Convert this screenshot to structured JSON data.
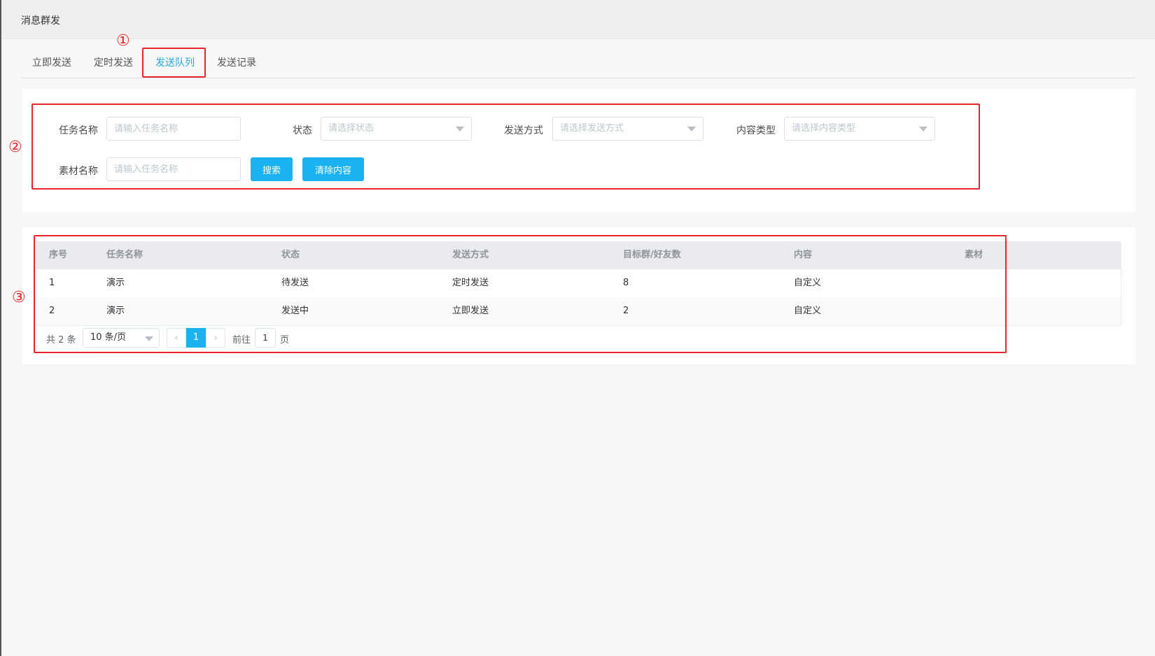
{
  "header": {
    "title": "消息群发"
  },
  "tabs": [
    {
      "label": "立即发送",
      "active": false
    },
    {
      "label": "定时发送",
      "active": false
    },
    {
      "label": "发送队列",
      "active": true
    },
    {
      "label": "发送记录",
      "active": false
    }
  ],
  "filters": {
    "task_name": {
      "label": "任务名称",
      "placeholder": "请输入任务名称"
    },
    "status": {
      "label": "状态",
      "placeholder": "请选择状态"
    },
    "send_method": {
      "label": "发送方式",
      "placeholder": "请选择发送方式"
    },
    "content_type": {
      "label": "内容类型",
      "placeholder": "请选择内容类型"
    },
    "material_name": {
      "label": "素材名称",
      "placeholder": "请输入任务名称"
    },
    "search_label": "搜索",
    "clear_label": "清除内容"
  },
  "table": {
    "columns": [
      "序号",
      "任务名称",
      "状态",
      "发送方式",
      "目标群/好友数",
      "内容",
      "素材"
    ],
    "rows": [
      [
        "1",
        "演示",
        "待发送",
        "定时发送",
        "8",
        "自定义",
        ""
      ],
      [
        "2",
        "演示",
        "发送中",
        "立即发送",
        "2",
        "自定义",
        ""
      ]
    ]
  },
  "pagination": {
    "total_text": "共 2 条",
    "page_size": "10 条/页",
    "prev_icon": "‹",
    "next_icon": "›",
    "current_page": "1",
    "goto_label": "前往",
    "goto_value": "1",
    "page_unit": "页"
  },
  "annotations": [
    "①",
    "②",
    "③"
  ],
  "colors": {
    "accent": "#1ab2f0",
    "annotation": "#e8262a"
  }
}
